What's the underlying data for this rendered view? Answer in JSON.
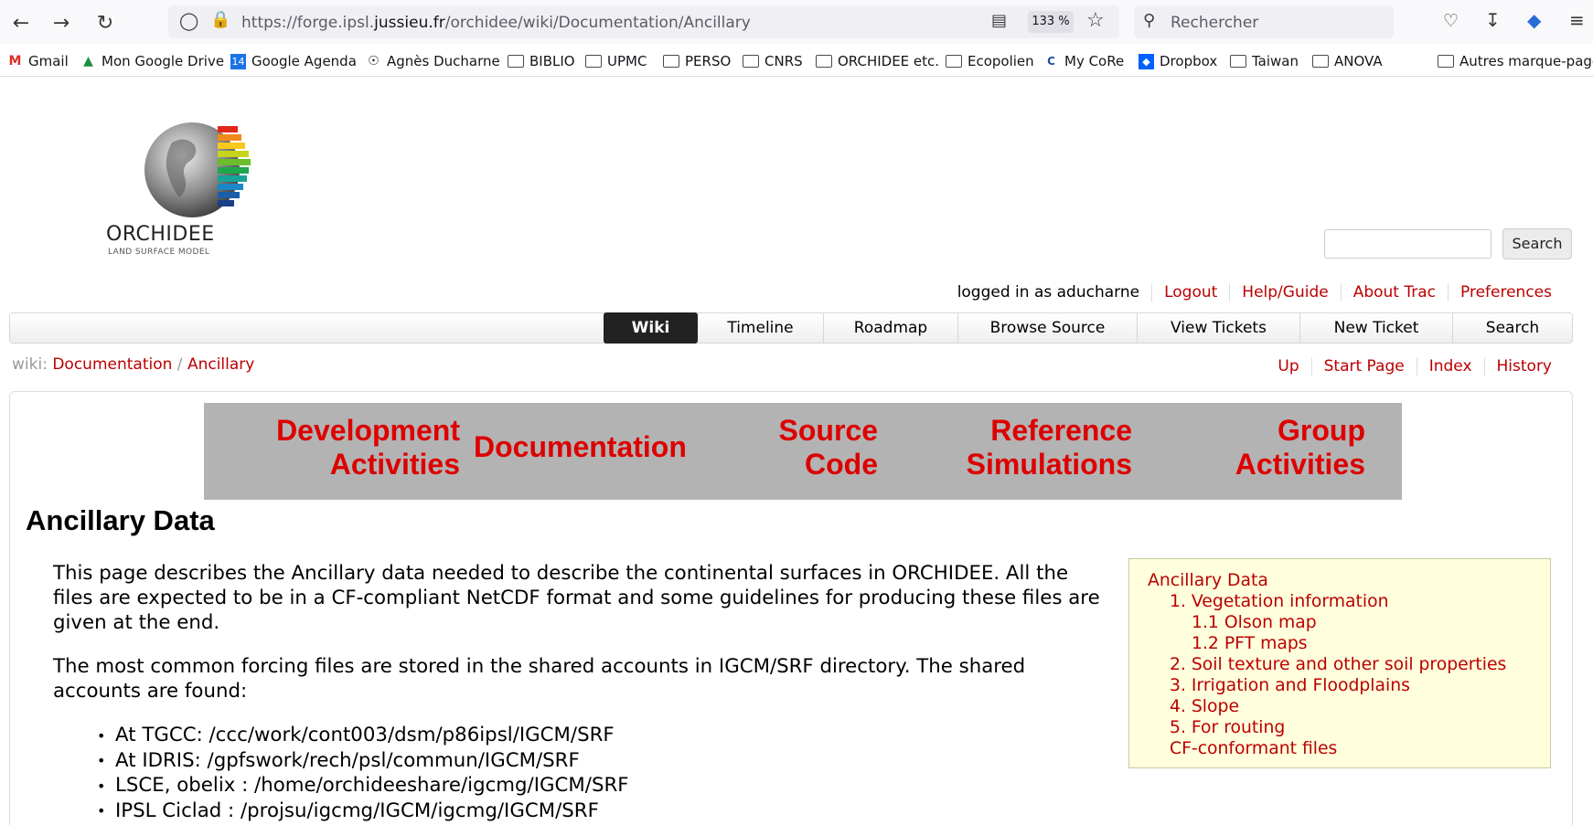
{
  "browser": {
    "url_prefix": "https://forge.ipsl.",
    "url_domain": "jussieu.fr",
    "url_path": "/orchidee/wiki/Documentation/Ancillary",
    "zoom": "133 %",
    "search_placeholder": "Rechercher",
    "bookmarks": [
      "Gmail",
      "Mon Google Drive",
      "Google Agenda",
      "Agnès Ducharne",
      "BIBLIO",
      "UPMC",
      "PERSO",
      "CNRS",
      "ORCHIDEE etc.",
      "Ecopolien",
      "My CoRe",
      "Dropbox",
      "Taiwan",
      "ANOVA",
      "Autres marque-pages"
    ]
  },
  "logo": {
    "name": "ORCHIDEE",
    "subtitle": "LAND SURFACE MODEL"
  },
  "header": {
    "search_button": "Search",
    "metanav": [
      "logged in as aducharne",
      "Logout",
      "Help/Guide",
      "About Trac",
      "Preferences"
    ]
  },
  "mainnav": [
    "Wiki",
    "Timeline",
    "Roadmap",
    "Browse Source",
    "View Tickets",
    "New Ticket",
    "Search"
  ],
  "breadcrumb": {
    "prefix": "wiki:",
    "parent": "Documentation",
    "sep": " / ",
    "current": "Ancillary"
  },
  "ctxnav": [
    "Up",
    "Start Page",
    "Index",
    "History"
  ],
  "banner": {
    "dev_1": "Development",
    "dev_2": "Activities",
    "doc": "Documentation",
    "src_1": "Source",
    "src_2": "Code",
    "ref_1": "Reference",
    "ref_2": "Simulations",
    "grp_1": "Group",
    "grp_2": "Activities"
  },
  "page": {
    "title": "Ancillary Data",
    "para1": "This page describes the Ancillary data needed to describe the continental surfaces in ORCHIDEE. All the files are expected to be in a CF-compliant NetCDF format and some guidelines for producing these files are given at the end.",
    "para2": "The most common forcing files are stored in the shared accounts in IGCM/SRF directory. The shared accounts are found:",
    "paths": [
      "At TGCC: /ccc/work/cont003/dsm/p86ipsl/IGCM/SRF",
      "At IDRIS: /gpfswork/rech/psl/commun/IGCM/SRF",
      "LSCE, obelix : /home/orchideeshare/igcmg/IGCM/SRF",
      "IPSL Ciclad : /projsu/igcmg/IGCM/igcmg/IGCM/SRF"
    ]
  },
  "toc": [
    "Ancillary Data",
    "1. Vegetation information",
    "1.1 Olson map",
    "1.2 PFT maps",
    "2. Soil texture and other soil properties",
    "3. Irrigation and Floodplains",
    "4. Slope",
    "5. For routing",
    "CF-conformant files"
  ],
  "colors": {
    "link": "#bb0000",
    "banner_bg": "#b3b3b3",
    "banner_text": "#dd0000",
    "toc_bg": "#ffffdd"
  }
}
